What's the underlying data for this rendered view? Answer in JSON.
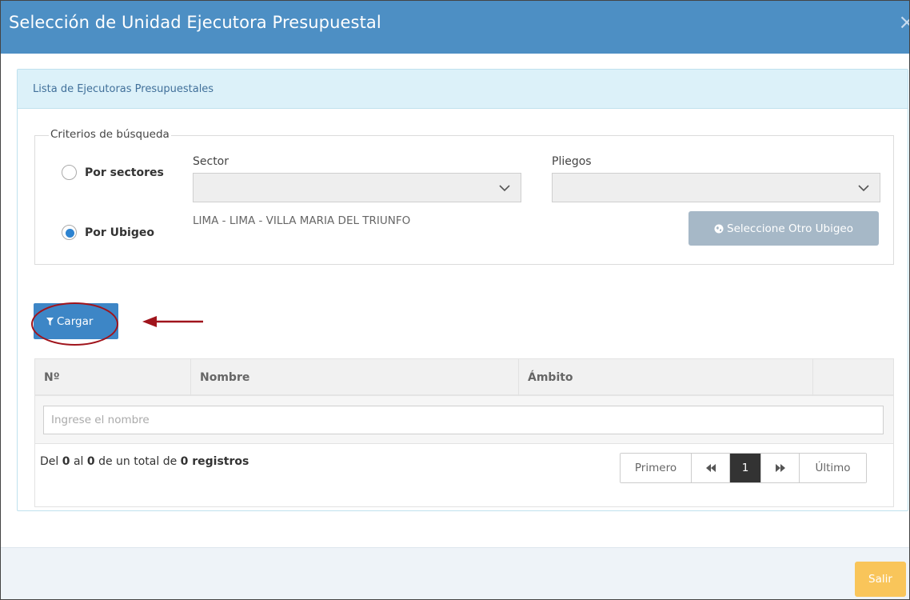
{
  "modal": {
    "title": "Selección de Unidad Ejecutora Presupuestal",
    "close_glyph": "×"
  },
  "panel": {
    "title": "Lista de Ejecutoras Presupuestales"
  },
  "criteria": {
    "legend": "Criterios de búsqueda",
    "option_sectores": {
      "label": "Por sectores",
      "checked": false
    },
    "option_ubigeo": {
      "label": "Por Ubigeo",
      "checked": true
    },
    "sector_label": "Sector",
    "sector_value": "",
    "pliegos_label": "Pliegos",
    "pliegos_value": "",
    "ubigeo_text": "LIMA - LIMA - VILLA MARIA DEL TRIUNFO",
    "select_other_button": "Seleccione Otro Ubigeo"
  },
  "actions": {
    "cargar_label": "Cargar"
  },
  "annotation": {
    "color": "#a0141c"
  },
  "table": {
    "columns": [
      "Nº",
      "Nombre",
      "Ámbito",
      ""
    ],
    "filter_placeholder": "Ingrese el nombre",
    "rows": [],
    "summary": {
      "prefix": "Del",
      "from": "0",
      "mid": "al",
      "to": "0",
      "total_text": "de un total de",
      "total": "0 registros"
    }
  },
  "pagination": {
    "first": "Primero",
    "prev_glyph": "«",
    "current_page": "1",
    "next_glyph": "»",
    "last": "Último"
  },
  "footer": {
    "exit_label": "Salir"
  },
  "colors": {
    "header": "#4d8fc4",
    "primary_button": "#3d86c6",
    "disabled_button": "#a6b8c7",
    "exit_button": "#f9c55a"
  }
}
